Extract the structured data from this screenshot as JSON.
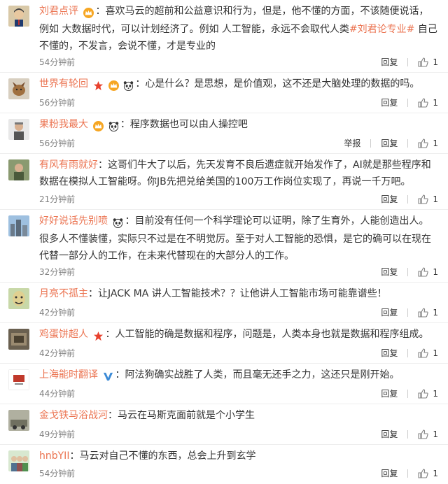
{
  "ui": {
    "reply_label": "回复",
    "report_label": "举报",
    "colors": {
      "username": "#eb7350",
      "time": "#808080",
      "text": "#333333",
      "verified_blue": "#3b8ad6"
    }
  },
  "comments": [
    {
      "user": "刘君点评",
      "badges": [
        "vip-crown-icon"
      ],
      "text_before": "喜欢马云的超前和公益意识和行为，但是，他不懂的方面，不该随便说话，例如 大数据时代，可以计划经济了。例如 人工智能，永远不会取代人类",
      "topic": "#刘君论专业#",
      "text_after": " 自己不懂的，不发言，会说不懂，才是专业的",
      "time": "54分钟前",
      "likes": "1",
      "show_report": false
    },
    {
      "user": "世界有轮回",
      "badges": [
        "star-icon",
        "vip-crown-icon",
        "panda-icon"
      ],
      "text_before": "心是什么？是思想，是价值观，这不还是大脑处理的数据的吗。",
      "time": "56分钟前",
      "likes": "1",
      "show_report": false
    },
    {
      "user": "果粉我最大",
      "badges": [
        "vip-crown-icon",
        "panda-icon"
      ],
      "text_before": "程序数据也可以由人操控吧",
      "time": "56分钟前",
      "likes": "1",
      "show_report": true
    },
    {
      "user": "有风有雨就好",
      "badges": [],
      "text_before": "这哥们牛大了以后，先天发育不良后遗症就开始发作了，AI就是那些程序和数据在模拟人工智能呀。你JB先把兑给美国的100万工作岗位实现了，再说一千万吧。",
      "time": "21分钟前",
      "likes": "1",
      "show_report": false
    },
    {
      "user": "好好说话先别喷",
      "badges": [
        "panda-icon"
      ],
      "text_before": "目前没有任何一个科学理论可以证明，除了生育外，人能创造出人。很多人不懂装懂，实际只不过是在不明觉厉。至于对人工智能的恐惧，是它的确可以在现在代替一部分人的工作，在未来代替现在的大部分人的工作。",
      "time": "32分钟前",
      "likes": "1",
      "show_report": false
    },
    {
      "user": "月亮不孤主",
      "badges": [],
      "text_before": "让JACK MA 讲人工智能技术？？让他讲人工智能市场可能靠谱些！",
      "time": "42分钟前",
      "likes": "1",
      "show_report": false
    },
    {
      "user": "鸡蛋饼超人",
      "badges": [
        "star-icon"
      ],
      "text_before": "人工智能的确是数据和程序，问题是，人类本身也就是数据和程序组成。",
      "time": "42分钟前",
      "likes": "1",
      "show_report": false
    },
    {
      "user": "上海能时翻译",
      "badges": [
        "verified-v-icon"
      ],
      "text_before": "阿法狗确实战胜了人类，而且毫无还手之力，这还只是刚开始。",
      "time": "44分钟前",
      "likes": "1",
      "show_report": false
    },
    {
      "user": "金戈铁马浴战河",
      "badges": [],
      "text_before": "马云在马斯克面前就是个小学生",
      "time": "49分钟前",
      "likes": "1",
      "show_report": false
    },
    {
      "user": "hnbYII",
      "badges": [],
      "text_before": "马云对自己不懂的东西，总会上升到玄学",
      "time": "54分钟前",
      "likes": "1",
      "show_report": false
    }
  ]
}
